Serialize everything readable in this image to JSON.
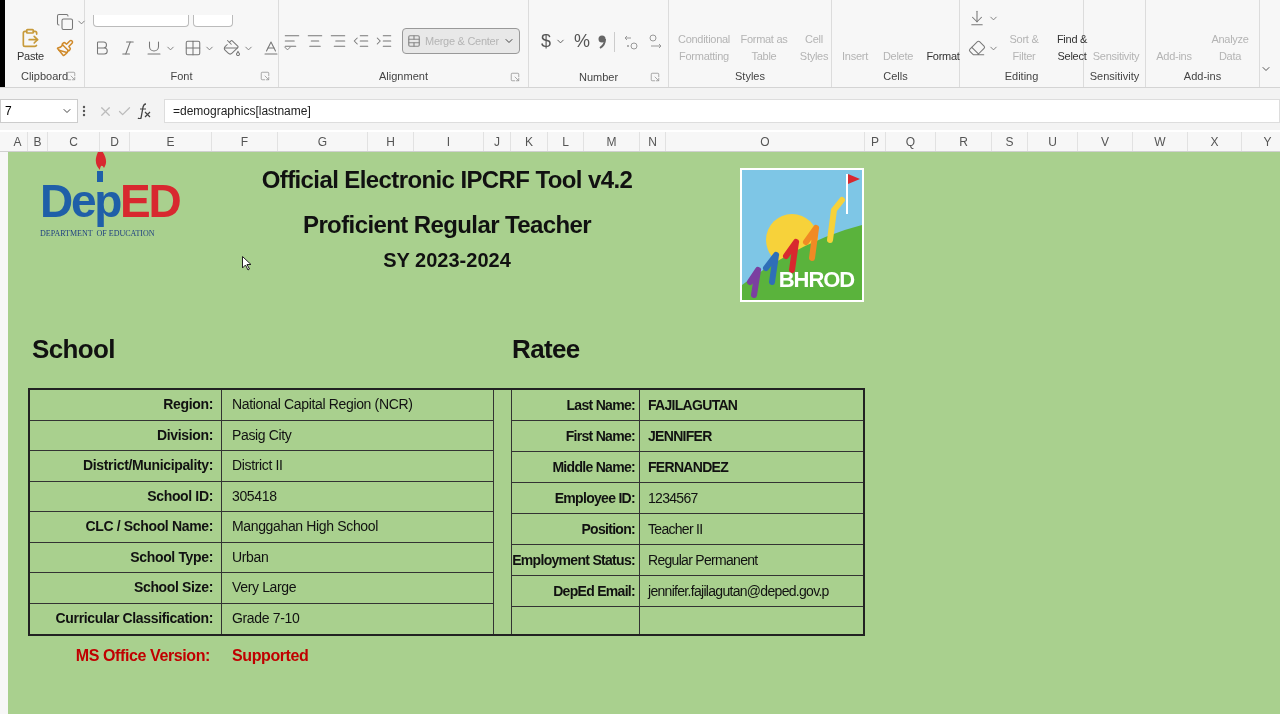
{
  "ribbon": {
    "groups": [
      {
        "label": "Clipboard",
        "launcher": true,
        "buttons": [
          {
            "label": "Paste",
            "disabled": false
          }
        ]
      },
      {
        "label": "Font",
        "launcher": true
      },
      {
        "label": "Alignment",
        "launcher": true,
        "buttons": [
          {
            "label": "Merge & Center",
            "disabled": true
          }
        ]
      },
      {
        "label": "Number",
        "launcher": true,
        "buttons": [
          {
            "label": "$",
            "disabled": false
          },
          {
            "label": "%",
            "disabled": false
          }
        ]
      },
      {
        "label": "Styles",
        "launcher": false,
        "buttons": [
          {
            "label": "Conditional Formatting",
            "disabled": true
          },
          {
            "label": "Format as Table",
            "disabled": true
          },
          {
            "label": "Cell Styles",
            "disabled": true
          }
        ]
      },
      {
        "label": "Cells",
        "launcher": false,
        "buttons": [
          {
            "label": "Insert",
            "disabled": true
          },
          {
            "label": "Delete",
            "disabled": true
          },
          {
            "label": "Format",
            "disabled": false
          }
        ]
      },
      {
        "label": "Editing",
        "launcher": false,
        "buttons": [
          {
            "label": "Sort & Filter",
            "disabled": true
          },
          {
            "label": "Find & Select",
            "disabled": false
          }
        ]
      },
      {
        "label": "Sensitivity",
        "launcher": false,
        "buttons": [
          {
            "label": "Sensitivity",
            "disabled": true
          }
        ]
      },
      {
        "label": "Add-ins",
        "launcher": false,
        "buttons": [
          {
            "label": "Add-ins",
            "disabled": true
          },
          {
            "label": "Analyze Data",
            "disabled": true
          }
        ]
      }
    ]
  },
  "formula_bar": {
    "name_box": "7",
    "formula": "=demographics[lastname]"
  },
  "columns": [
    "A",
    "B",
    "C",
    "D",
    "E",
    "F",
    "G",
    "H",
    "I",
    "J",
    "K",
    "L",
    "M",
    "N",
    "O",
    "P",
    "Q",
    "R",
    "S",
    "U",
    "V",
    "W",
    "X",
    "Y"
  ],
  "sheet": {
    "logo": {
      "wordmark": [
        "Dep",
        "ED"
      ],
      "tagline": [
        "DEPARTMENT",
        "OF EDUCATION"
      ]
    },
    "titles": [
      "Official Electronic IPCRF Tool v4.2",
      "Proficient Regular Teacher",
      "SY 2023-2024"
    ],
    "badge_logo": {
      "text": "BHROD"
    },
    "school": {
      "heading": "School",
      "rows": [
        {
          "label": "Region:",
          "value": "National Capital Region (NCR)"
        },
        {
          "label": "Division:",
          "value": "Pasig City"
        },
        {
          "label": "District/Municipality:",
          "value": "District II"
        },
        {
          "label": "School ID:",
          "value": "305418"
        },
        {
          "label": "CLC / School Name:",
          "value": "Manggahan High School"
        },
        {
          "label": "School Type:",
          "value": "Urban"
        },
        {
          "label": "School Size:",
          "value": "Very Large"
        },
        {
          "label": "Curricular Classification:",
          "value": "Grade 7-10"
        }
      ]
    },
    "ratee": {
      "heading": "Ratee",
      "rows": [
        {
          "label": "Last Name:",
          "value": "FAJILAGUTAN",
          "bold": true
        },
        {
          "label": "First Name:",
          "value": "JENNIFER",
          "bold": true
        },
        {
          "label": "Middle Name:",
          "value": "FERNANDEZ",
          "bold": true
        },
        {
          "label": "Employee ID:",
          "value": "1234567",
          "bold": false
        },
        {
          "label": "Position:",
          "value": "Teacher II",
          "bold": false
        },
        {
          "label": "Employment Status:",
          "value": "Regular Permanent",
          "bold": false
        },
        {
          "label": "DepEd Email:",
          "value": "jennifer.fajilagutan@deped.gov.p",
          "bold": false
        }
      ]
    },
    "office_version": {
      "label": "MS Office Version:",
      "value": "Supported"
    }
  }
}
